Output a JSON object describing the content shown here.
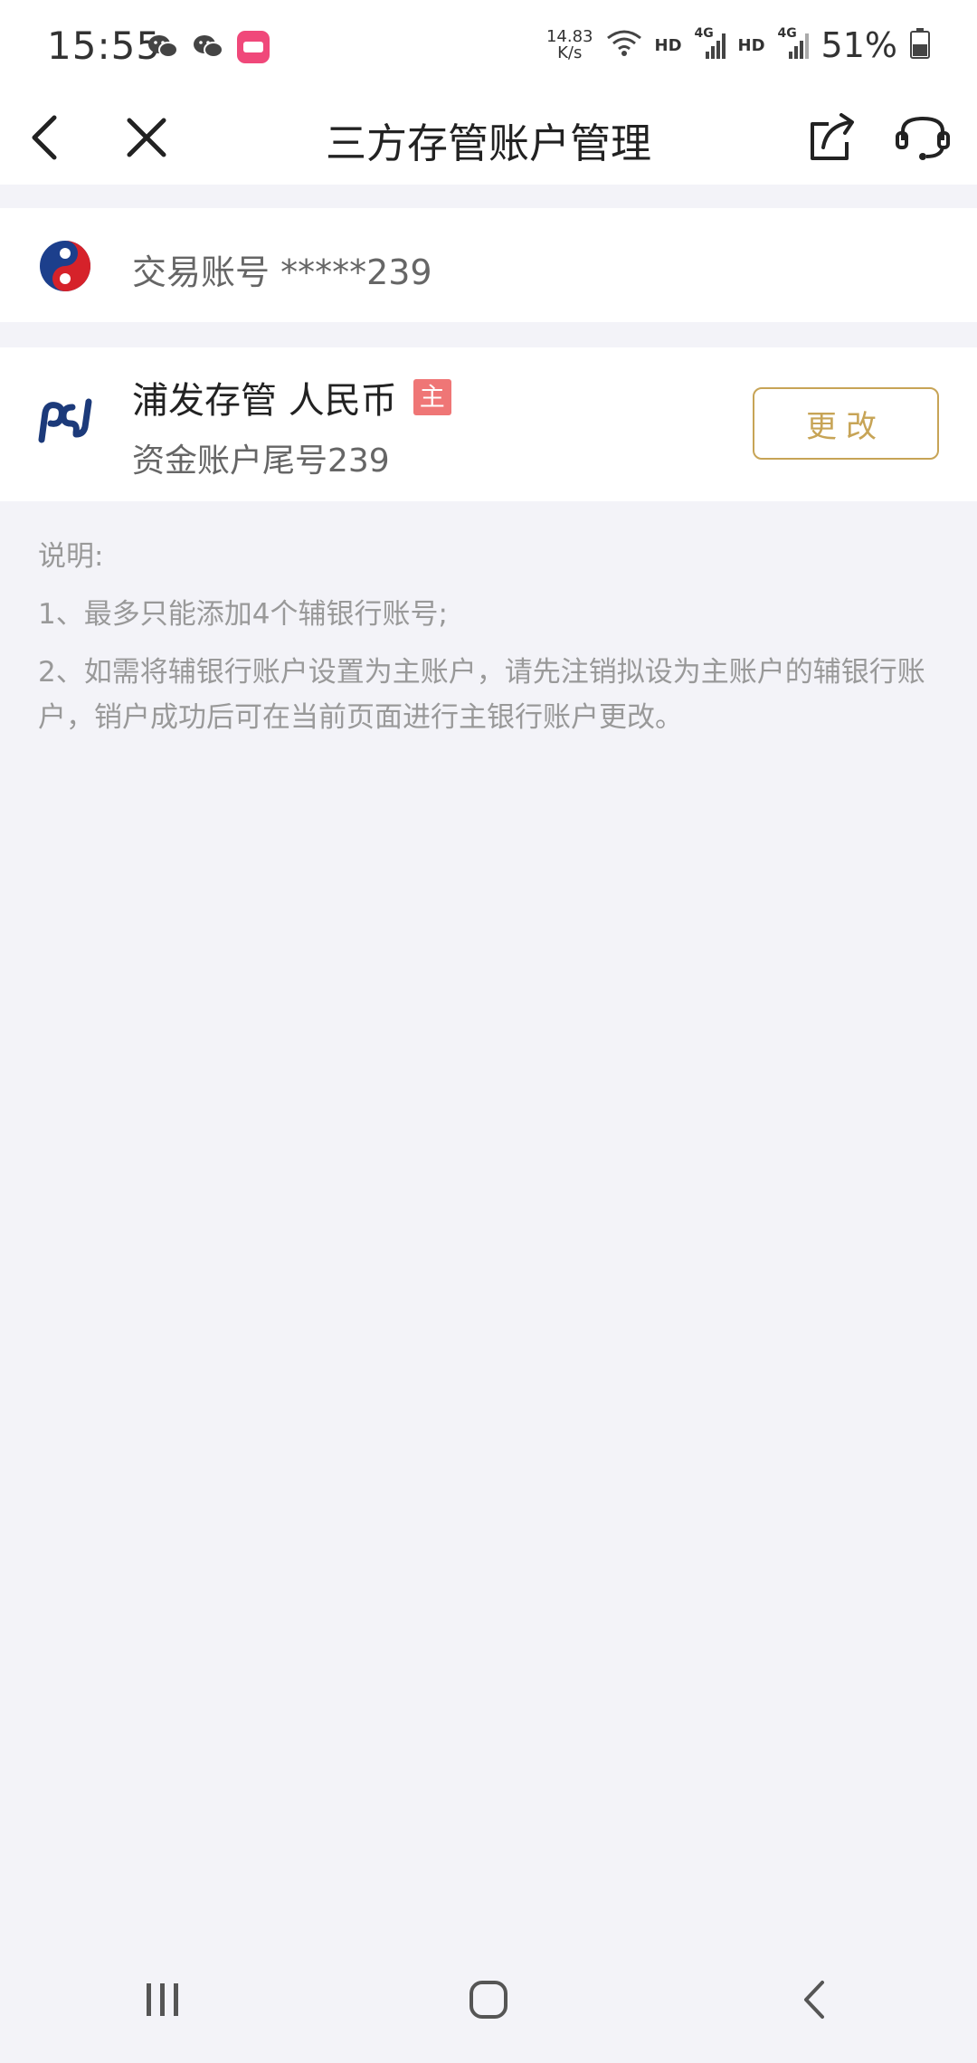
{
  "status_bar": {
    "time": "15:55",
    "net_speed_value": "14.83",
    "net_speed_unit": "K/s",
    "hd1": "HD",
    "hd2": "HD",
    "signal_label1": "4G",
    "signal_label2": "4G",
    "battery": "51%",
    "left_icons": [
      "wechat-icon",
      "wechat-icon",
      "app-icon"
    ]
  },
  "nav": {
    "title": "三方存管账户管理",
    "back_icon": "back-arrow-icon",
    "close_icon": "close-icon",
    "share_icon": "share-icon",
    "service_icon": "customer-service-icon"
  },
  "trade_account": {
    "label": "交易账号 *****239",
    "logo": "broker-logo"
  },
  "bank_account": {
    "name": "浦发存管 人民币",
    "badge": "主",
    "sub": "资金账户尾号239",
    "change_button": "更改",
    "logo": "spdb-logo"
  },
  "notes": {
    "title": "说明:",
    "item1": "1、最多只能添加4个辅银行账号;",
    "item2": "2、如需将辅银行账户设置为主账户，请先注销拟设为主账户的辅银行账户，销户成功后可在当前页面进行主银行账户更改。"
  },
  "colors": {
    "accent": "#c7a456",
    "badge": "#ef7676",
    "background": "#f3f3f8"
  }
}
